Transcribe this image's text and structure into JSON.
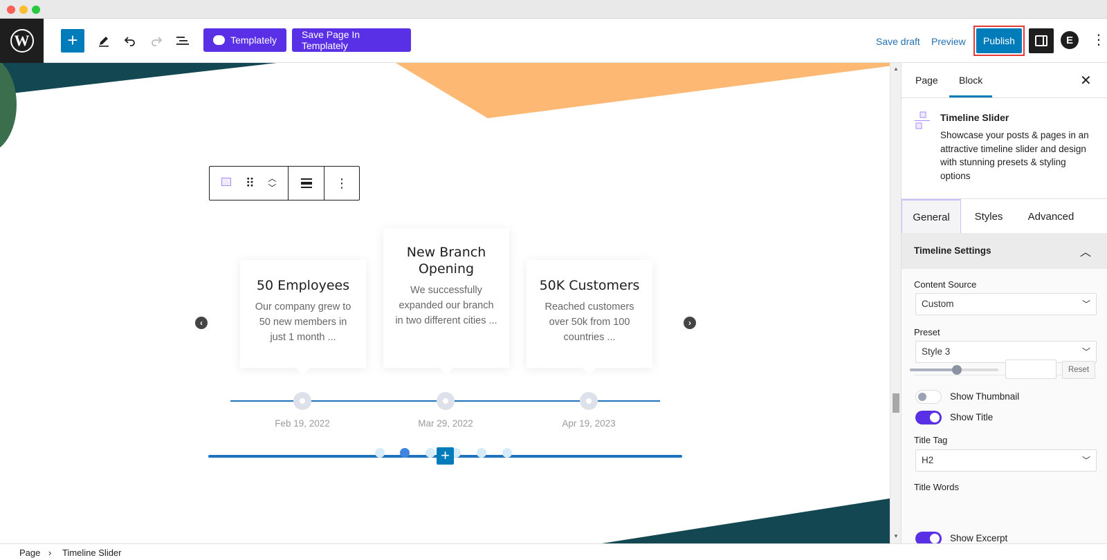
{
  "toolbar": {
    "wp_logo": "W",
    "add_label": "+",
    "templately_label": "Templately",
    "save_templately_label": "Save Page In Templately",
    "save_draft_label": "Save draft",
    "preview_label": "Preview",
    "publish_label": "Publish",
    "ea_label": "E",
    "icons": [
      "plus-icon",
      "pencil-icon",
      "undo-icon",
      "redo-icon",
      "list-view-icon",
      "cloud-icon",
      "sidebar-icon",
      "kebab-icon"
    ]
  },
  "timeline": {
    "cards": [
      {
        "title": "50 Employees",
        "excerpt": "Our company grew to 50 new members in just 1 month ...",
        "date": "Feb 19, 2022"
      },
      {
        "title": "New Branch Opening",
        "excerpt": "We successfully expanded our branch in two different cities ...",
        "date": "Mar 29, 2022"
      },
      {
        "title": "50K Customers",
        "excerpt": "Reached customers over 50k from 100 countries ...",
        "date": "Apr 19, 2023"
      }
    ],
    "prev_arrow": "‹",
    "next_arrow": "›",
    "pager_dots": 6,
    "pager_active_index": 1
  },
  "colors": {
    "accent_blue": "#007cba",
    "templately_purple": "#5930e5",
    "decor_teal": "#134852",
    "decor_orange": "#fdb974",
    "decor_green": "#3a6e4c",
    "timeline_line": "#1e73be"
  },
  "sidebar": {
    "tabs": {
      "page": "Page",
      "block": "Block"
    },
    "close": "✕",
    "block_title": "Timeline Slider",
    "block_desc": "Showcase your posts & pages in an attractive timeline slider and design with stunning presets & styling options",
    "inner_tabs": {
      "general": "General",
      "styles": "Styles",
      "advanced": "Advanced"
    },
    "section_title": "Timeline Settings",
    "content_source_label": "Content Source",
    "content_source_value": "Custom",
    "preset_label": "Preset",
    "preset_value": "Style 3",
    "show_thumbnail_label": "Show Thumbnail",
    "show_thumbnail_on": false,
    "show_title_label": "Show Title",
    "show_title_on": true,
    "title_tag_label": "Title Tag",
    "title_tag_value": "H2",
    "title_words_label": "Title Words",
    "title_words_level_pct": 53,
    "reset_label": "Reset",
    "show_excerpt_label": "Show Excerpt",
    "show_excerpt_on": true
  },
  "footer": {
    "crumb1": "Page",
    "sep": "›",
    "crumb2": "Timeline Slider"
  }
}
